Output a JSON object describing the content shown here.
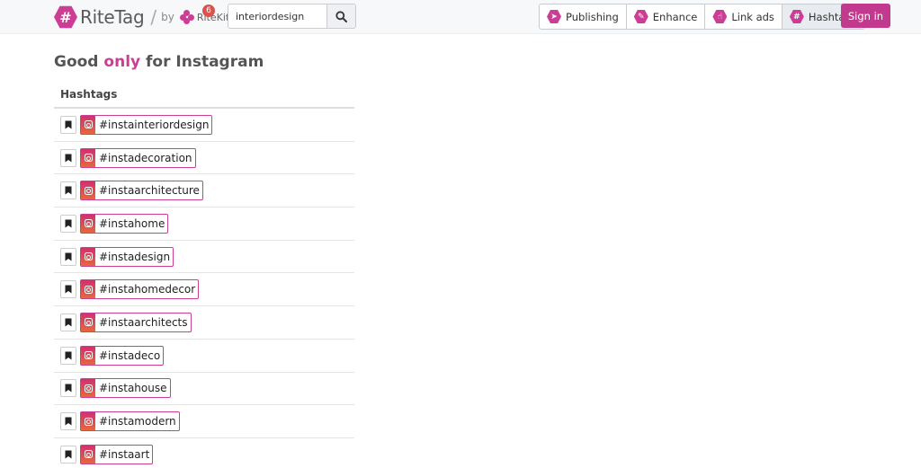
{
  "header": {
    "logo_text": "RiteTag",
    "logo_slash": "/",
    "logo_by": "by",
    "ritekit_text": "RiteKit",
    "badge_count": "6",
    "search_value": "interiordesign",
    "nav": [
      {
        "label": "Publishing",
        "icon": "publishing-icon"
      },
      {
        "label": "Enhance",
        "icon": "enhance-icon"
      },
      {
        "label": "Link ads",
        "icon": "link-ads-icon"
      },
      {
        "label": "Hashtags",
        "icon": "hashtags-icon"
      }
    ],
    "signin_label": "Sign in"
  },
  "main": {
    "title_prefix": "Good ",
    "title_accent": "only",
    "title_suffix": " for Instagram",
    "column_header": "Hashtags",
    "hashtags": [
      "#instainteriordesign",
      "#instadecoration",
      "#instaarchitecture",
      "#instahome",
      "#instadesign",
      "#instahomedecor",
      "#instaarchitects",
      "#instadeco",
      "#instahouse",
      "#instamodern",
      "#instaart"
    ]
  },
  "colors": {
    "brand": "#cc3d95",
    "signin": "#c23a8e",
    "badge": "#d9534f"
  }
}
